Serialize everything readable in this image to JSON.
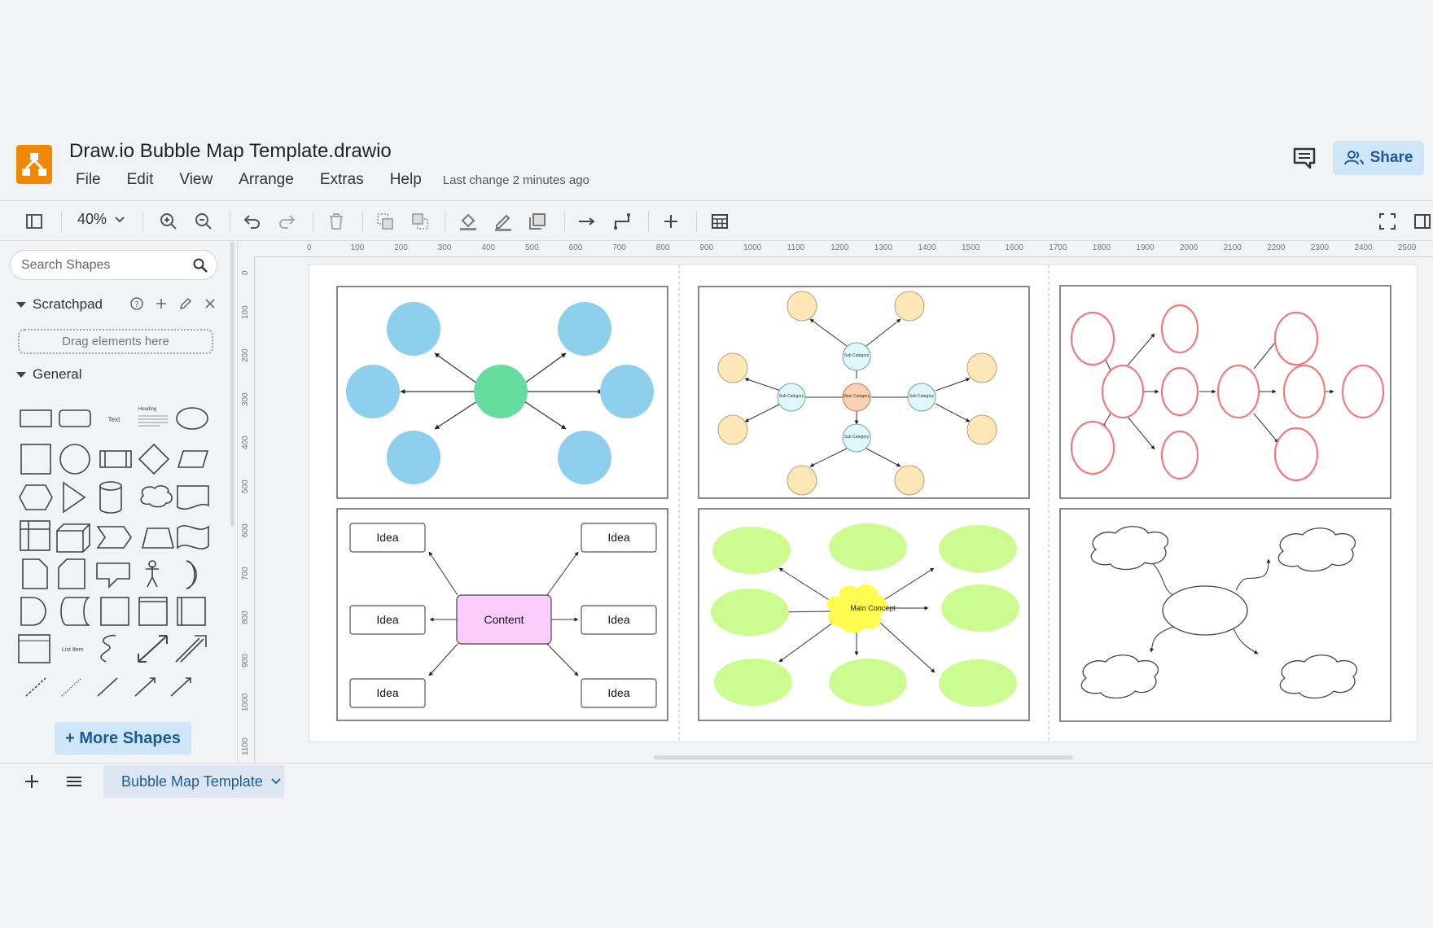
{
  "app": {
    "title": "Draw.io Bubble Map Template.drawio",
    "last_change": "Last change 2 minutes ago",
    "menu": [
      "File",
      "Edit",
      "View",
      "Arrange",
      "Extras",
      "Help"
    ],
    "share_label": "Share"
  },
  "toolbar": {
    "zoom": "40%"
  },
  "sidebar": {
    "search_placeholder": "Search Shapes",
    "scratchpad_title": "Scratchpad",
    "drag_hint": "Drag elements here",
    "general_title": "General",
    "shape_text_label": "Text",
    "shape_heading_label": "Heading",
    "shape_list_label": "List Item",
    "more_shapes": "+ More Shapes"
  },
  "rulers": {
    "h": [
      "0",
      "100",
      "200",
      "300",
      "400",
      "500",
      "600",
      "700",
      "800",
      "900",
      "1000",
      "1100",
      "1200",
      "1300",
      "1400",
      "1500",
      "1600",
      "1700",
      "1800",
      "1900",
      "2000",
      "2100",
      "2200",
      "2300",
      "2400",
      "2500"
    ],
    "v": [
      "0",
      "100",
      "200",
      "300",
      "400",
      "500",
      "600",
      "700",
      "800",
      "900",
      "1000",
      "1100"
    ]
  },
  "diagram": {
    "sub_category": "Sub Category",
    "main_category": "Main Category",
    "content_label": "Content",
    "idea_label": "Idea",
    "main_concept": "Main Concept"
  },
  "bottom": {
    "page_tab": "Bubble Map Template"
  },
  "colors": {
    "blue": "#8ecfee",
    "green": "#66dd9e",
    "cream": "#fde7b8",
    "cyan": "#dff8fa",
    "salmon": "#fbd1b3",
    "pink_stroke": "#ef7b7b",
    "lime": "#ccfb8f",
    "yellow": "#fffb4f",
    "magenta": "#fccdfa",
    "accent": "#f08705"
  }
}
